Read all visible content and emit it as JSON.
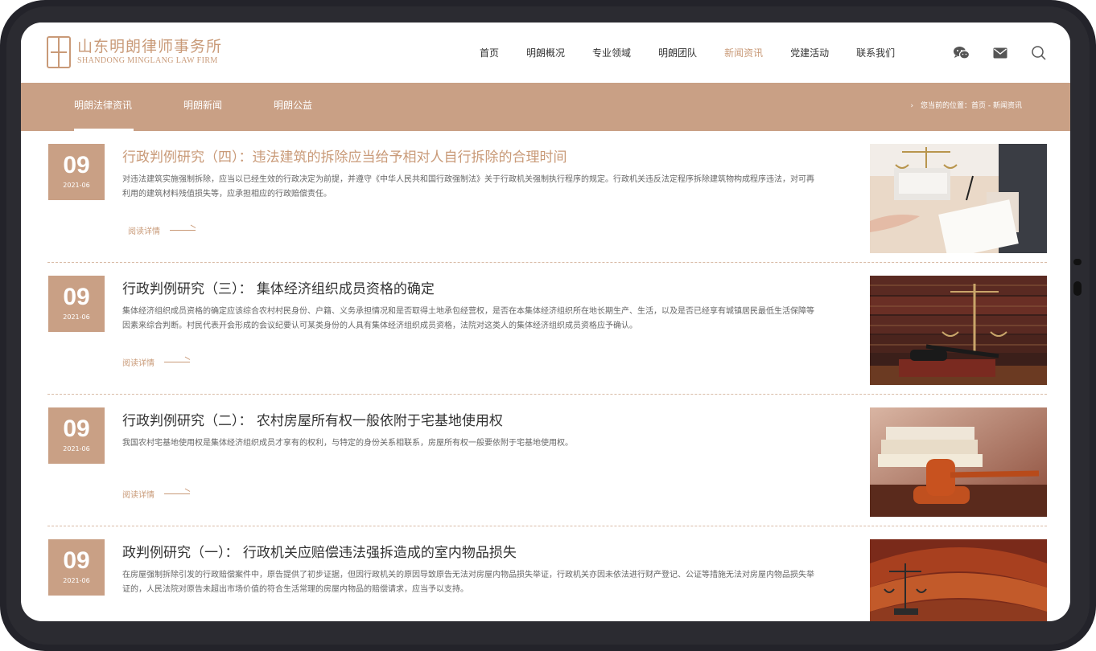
{
  "brand": {
    "name_cn": "山东明朗律师事务所",
    "name_en": "SHANDONG MINGLANG LAW FIRM"
  },
  "nav": [
    {
      "label": "首页"
    },
    {
      "label": "明朗概况"
    },
    {
      "label": "专业领域"
    },
    {
      "label": "明朗团队"
    },
    {
      "label": "新闻资讯",
      "active": true
    },
    {
      "label": "党建活动"
    },
    {
      "label": "联系我们"
    }
  ],
  "header_icons": [
    "wechat-icon",
    "mail-icon",
    "search-icon"
  ],
  "subnav": {
    "tabs": [
      {
        "label": "明朗法律资讯",
        "active": true
      },
      {
        "label": "明朗新闻"
      },
      {
        "label": "明朗公益"
      }
    ],
    "breadcrumb": "您当前的位置：首页 - 新闻资讯"
  },
  "articles": [
    {
      "day": "09",
      "ym": "2021-06",
      "title": "行政判例研究（四）：违法建筑的拆除应当给予相对人自行拆除的合理时间",
      "desc": "对违法建筑实施强制拆除，应当以已经生效的行政决定为前提，并遵守《中华人民共和国行政强制法》关于行政机关强制执行程序的规定。行政机关违反法定程序拆除建筑物构成程序违法，对可再利用的建筑材料残值损失等，应承担相应的行政赔偿责任。",
      "more": "阅读详情",
      "image": "scales-and-handwriting"
    },
    {
      "day": "09",
      "ym": "2021-06",
      "title": "行政判例研究（三）： 集体经济组织成员资格的确定",
      "desc": "集体经济组织成员资格的确定应该综合农村村民身份、户籍、义务承担情况和是否取得土地承包经营权，是否在本集体经济组织所在地长期生产、生活，以及是否已经享有城镇居民最低生活保障等因素来综合判断。村民代表开会形成的会议纪要认可某类身份的人具有集体经济组织成员资格，法院对这类人的集体经济组织成员资格应予确认。",
      "more": "阅读详情",
      "image": "gavel-and-books"
    },
    {
      "day": "09",
      "ym": "2021-06",
      "title": "行政判例研究（二）： 农村房屋所有权一般依附于宅基地使用权",
      "desc": "我国农村宅基地使用权是集体经济组织成员才享有的权利，与特定的身份关系相联系，房屋所有权一般要依附于宅基地使用权。",
      "more": "阅读详情",
      "image": "gavel-on-desk"
    },
    {
      "day": "09",
      "ym": "2021-06",
      "title": "政判例研究（一）： 行政机关应赔偿违法强拆造成的室内物品损失",
      "desc": "在房屋强制拆除引发的行政赔偿案件中，原告提供了初步证据，但因行政机关的原因导致原告无法对房屋内物品损失举证，行政机关亦因未依法进行财产登记、公证等措施无法对房屋内物品损失举证的，人民法院对原告未超出市场价值的符合生活常理的房屋内物品的赔偿请求，应当予以支持。",
      "more": "阅读详情",
      "image": "courtroom"
    }
  ],
  "colors": {
    "accent": "#c99a78",
    "subbar": "#c9a085"
  }
}
